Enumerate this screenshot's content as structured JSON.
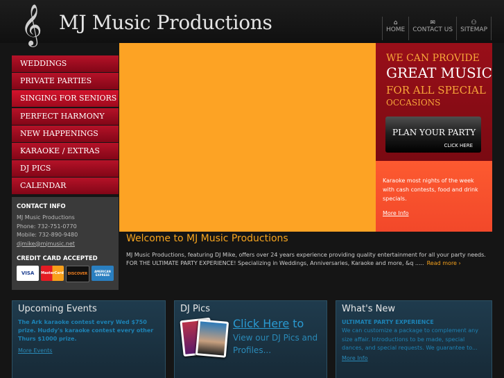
{
  "header": {
    "clef_glyph": "𝄞",
    "title": "MJ Music Productions",
    "nav": [
      {
        "icon": "home-icon",
        "glyph": "⌂",
        "label": "HOME"
      },
      {
        "icon": "envelope-icon",
        "glyph": "✉",
        "label": "CONTACT US"
      },
      {
        "icon": "sitemap-icon",
        "glyph": "⚇",
        "label": "SITEMAP"
      }
    ]
  },
  "sidebar": {
    "items": [
      {
        "label": "WEDDINGS"
      },
      {
        "label": "PRIVATE PARTIES"
      },
      {
        "label": "SINGING FOR SENIORS"
      },
      {
        "label": "PERFECT HARMONY"
      },
      {
        "label": "NEW HAPPENINGS"
      },
      {
        "label": "KARAOKE / EXTRAS"
      },
      {
        "label": "DJ PICS"
      },
      {
        "label": "CALENDAR"
      }
    ]
  },
  "contact": {
    "heading": "CONTACT INFO",
    "name": "MJ Music Productions",
    "phone": "Phone: 732-751-0770",
    "mobile": "Mobile: 732-890-9480",
    "email": "djmike@mjmusic.net",
    "cc_heading": "CREDIT CARD ACCEPTED",
    "cards": [
      "VISA",
      "MasterCard",
      "DISCOVER",
      "AMERICAN EXPRESS"
    ]
  },
  "promo": {
    "line1": "WE CAN PROVIDE",
    "line2": "GREAT MUSIC",
    "line3": "FOR ALL SPECIAL",
    "line4": "OCCASIONS",
    "button_title": "PLAN YOUR PARTY",
    "button_sub": "CLICK HERE"
  },
  "karaoke": {
    "text": "Karaoke most nights of the week with cash contests, food and drink specials.",
    "link": "More Info"
  },
  "welcome": {
    "title": "Welcome to MJ Music Productions",
    "body": "MJ Music Productions, featuring DJ Mike, offers over 24 years experience providing quality entertainment for all your party needs. FOR THE ULTIMATE PARTY EXPERIENCE! Specializing in Weddings, Anniversaries, Karaoke and more, &q .....",
    "read_more": "Read more ›"
  },
  "boxes": {
    "events": {
      "title": "Upcoming Events",
      "bold": "The Ark karaoke contest every Wed $750 prize. Huddy's karaoke contest every other Thurs $1000 prize.",
      "link": "More Events"
    },
    "djpics": {
      "title": "DJ Pics",
      "click": "Click Here",
      "to": " to",
      "sub": "View our DJ Pics and Profiles..."
    },
    "whatsnew": {
      "title": "What's New",
      "bold": "ULTIMATE PARTY EXPERIENCE",
      "text": "We can customize a package to complement any size affair. Introductions to be made, special dances, and special requests. We guarantee to...",
      "link": "More Info"
    }
  },
  "colors": {
    "nav_red": "#b51228",
    "banner_orange": "#fda324",
    "accent_orange": "#f7a51f",
    "box_blue": "#1d82b4"
  }
}
